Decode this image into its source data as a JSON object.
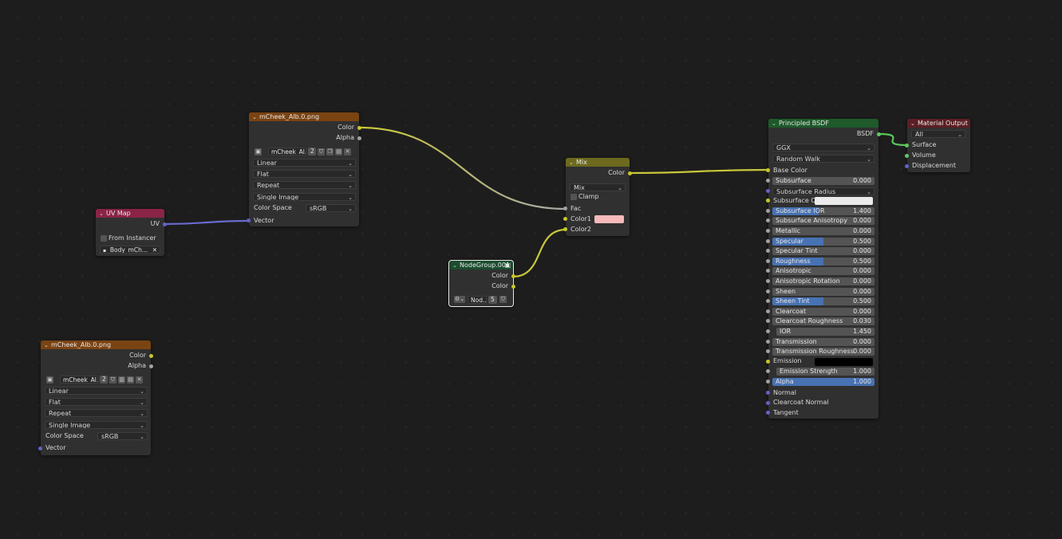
{
  "image_tex_top": {
    "title": "mCheek_Alb.0.png",
    "out_color": "Color",
    "out_alpha": "Alpha",
    "image_name": "mCheek_Al...",
    "users": "2",
    "interpolation": "Linear",
    "projection": "Flat",
    "extension": "Repeat",
    "source": "Single Image",
    "color_space_label": "Color Space",
    "color_space": "sRGB",
    "in_vector": "Vector"
  },
  "image_tex_bottom": {
    "title": "mCheek_Alb.0.png",
    "out_color": "Color",
    "out_alpha": "Alpha",
    "image_name": "mCheek_Al...",
    "users": "2",
    "interpolation": "Linear",
    "projection": "Flat",
    "extension": "Repeat",
    "source": "Single Image",
    "color_space_label": "Color Space",
    "color_space": "sRGB",
    "in_vector": "Vector"
  },
  "uv_map": {
    "title": "UV Map",
    "out_uv": "UV",
    "from_instancer": "From Instancer",
    "uv_name": "Body_mCh..."
  },
  "mix": {
    "title": "Mix",
    "out_color": "Color",
    "blend": "Mix",
    "clamp": "Clamp",
    "in_fac": "Fac",
    "in_color1": "Color1",
    "in_color2": "Color2",
    "color1_swatch": "#f7b9b9"
  },
  "node_group": {
    "title": "NodeGroup.001",
    "out_color1": "Color",
    "out_color2": "Color",
    "group_name": "Nod...",
    "users": "5"
  },
  "bsdf": {
    "title": "Principled BSDF",
    "out_bsdf": "BSDF",
    "distribution": "GGX",
    "subsurface_method": "Random Walk",
    "base_color": "Base Color",
    "fields": [
      {
        "label": "Subsurface",
        "value": "0.000",
        "fill": 0
      },
      {
        "label": "Subsurface Radius",
        "value": "",
        "fill": 0,
        "dropdown": true
      },
      {
        "label": "Subsurface C...",
        "value": "",
        "fill": 0,
        "color": "#ebebeb"
      },
      {
        "label": "Subsurface IOR",
        "value": "1.400",
        "fill": 0.45
      },
      {
        "label": "Subsurface Anisotropy",
        "value": "0.000",
        "fill": 0
      },
      {
        "label": "Metallic",
        "value": "0.000",
        "fill": 0
      },
      {
        "label": "Specular",
        "value": "0.500",
        "fill": 0.5
      },
      {
        "label": "Specular Tint",
        "value": "0.000",
        "fill": 0
      },
      {
        "label": "Roughness",
        "value": "0.500",
        "fill": 0.5
      },
      {
        "label": "Anisotropic",
        "value": "0.000",
        "fill": 0
      },
      {
        "label": "Anisotropic Rotation",
        "value": "0.000",
        "fill": 0
      },
      {
        "label": "Sheen",
        "value": "0.000",
        "fill": 0
      },
      {
        "label": "Sheen Tint",
        "value": "0.500",
        "fill": 0.5
      },
      {
        "label": "Clearcoat",
        "value": "0.000",
        "fill": 0
      },
      {
        "label": "Clearcoat Roughness",
        "value": "0.030",
        "fill": 0
      },
      {
        "label": "IOR",
        "value": "1.450",
        "fill": 0
      },
      {
        "label": "Transmission",
        "value": "0.000",
        "fill": 0
      },
      {
        "label": "Transmission Roughness",
        "value": "0.000",
        "fill": 0
      },
      {
        "label": "Emission",
        "value": "",
        "fill": 0,
        "color": "#000000"
      },
      {
        "label": "Emission Strength",
        "value": "1.000",
        "fill": 0
      },
      {
        "label": "Alpha",
        "value": "1.000",
        "fill": 1
      }
    ],
    "normal": "Normal",
    "clearcoat_normal": "Clearcoat Normal",
    "tangent": "Tangent"
  },
  "material_output": {
    "title": "Material Output",
    "target": "All",
    "in_surface": "Surface",
    "in_volume": "Volume",
    "in_displacement": "Displacement"
  },
  "colors": {
    "wire_color": "#c8c83a",
    "wire_vector": "#6a6ad0",
    "wire_shader": "#5cc95c",
    "wire_gray": "#a8a8a8",
    "accent_blue": "#4772b3"
  }
}
